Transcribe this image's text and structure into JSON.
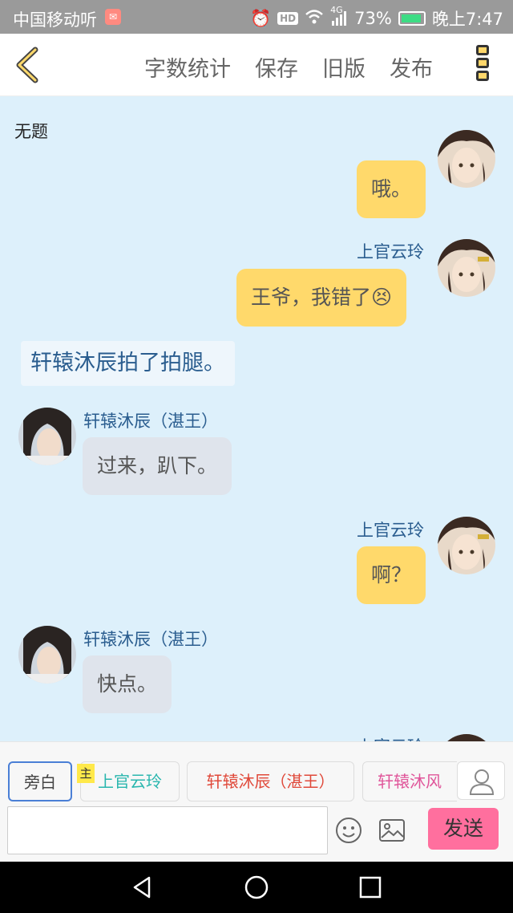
{
  "status": {
    "carrier": "中国移动",
    "listen": "听",
    "signal_label": "4G",
    "hd_label": "HD",
    "battery": "73%",
    "time": "晚上7:47"
  },
  "header": {
    "actions": [
      "字数统计",
      "保存",
      "旧版",
      "发布"
    ]
  },
  "chat": {
    "title": "无题",
    "messages": {
      "m1": {
        "text": "哦。"
      },
      "m2": {
        "name": "上官云玲",
        "text": "王爷，我错了😣"
      },
      "narration": {
        "text": "轩辕沐辰拍了拍腿。"
      },
      "m3": {
        "name": "轩辕沐辰（湛王）",
        "text": "过来，趴下。"
      },
      "m4": {
        "name": "上官云玲",
        "text": "啊？"
      },
      "m5": {
        "name": "轩辕沐辰（湛王）",
        "text": "快点。"
      },
      "m6": {
        "name": "上官云玲"
      }
    }
  },
  "roles": {
    "narrator": "旁白",
    "main_tag": "主",
    "items": [
      "上官云玲",
      "轩辕沐辰（湛王）",
      "轩辕沐风"
    ],
    "colors": {
      "narrator": "#444444",
      "role1": "#29b6ae",
      "role2": "#e0493a",
      "role3": "#e0559a"
    }
  },
  "composer": {
    "input_value": "",
    "send_label": "发送"
  },
  "colors": {
    "chat_bg": "#ddf0fb",
    "my_bubble": "#ffd96b",
    "other_bubble": "#dfe4ec",
    "send_button": "#ff6f9e"
  }
}
